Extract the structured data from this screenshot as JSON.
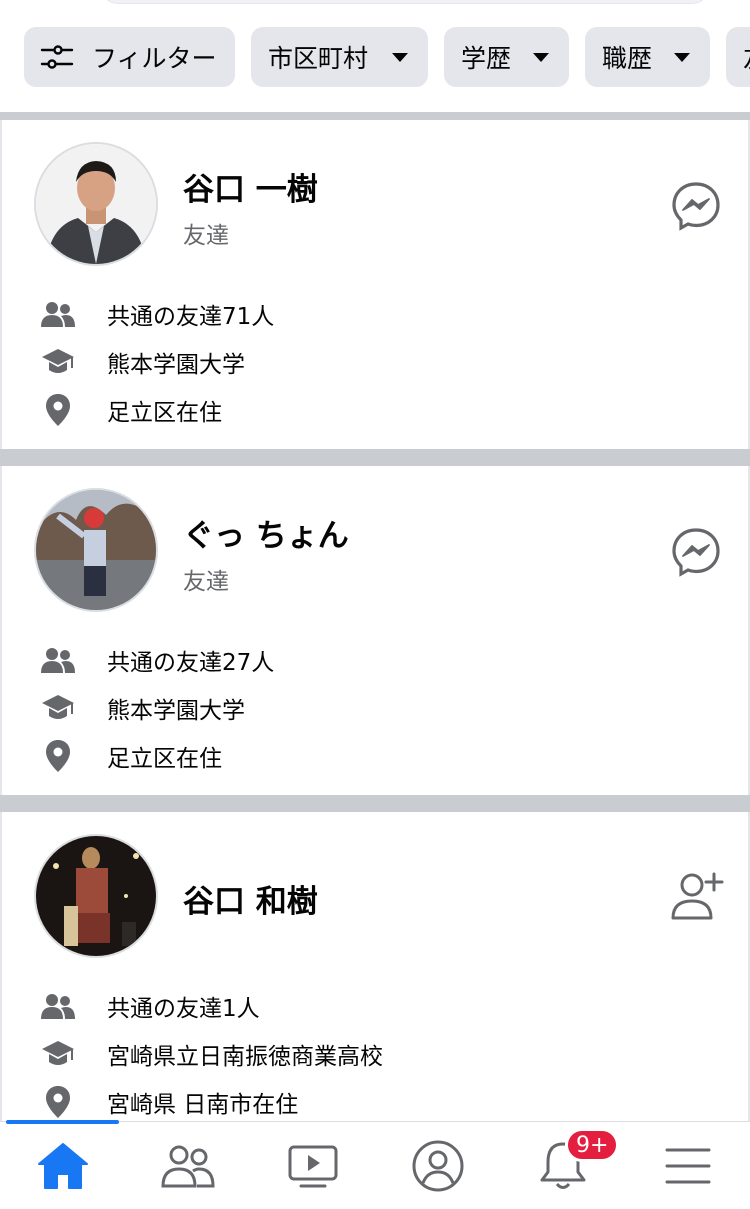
{
  "filters": [
    {
      "label": "フィルター",
      "icon": "sliders-icon"
    },
    {
      "label": "市区町村",
      "icon": "caret-down-icon"
    },
    {
      "label": "学歴",
      "icon": "caret-down-icon"
    },
    {
      "label": "職歴",
      "icon": "caret-down-icon"
    },
    {
      "label": "友",
      "icon": "caret-down-icon"
    }
  ],
  "results": [
    {
      "name": "谷口 一樹",
      "relation": "友達",
      "action_icon": "messenger-icon",
      "mutual_friends": "共通の友達71人",
      "education": "熊本学園大学",
      "location": "足立区在住"
    },
    {
      "name": "ぐっ ちょん",
      "relation": "友達",
      "action_icon": "messenger-icon",
      "mutual_friends": "共通の友達27人",
      "education": "熊本学園大学",
      "location": "足立区在住"
    },
    {
      "name": "谷口 和樹",
      "relation": "",
      "action_icon": "add-friend-icon",
      "mutual_friends": "共通の友達1人",
      "education": "宮崎県立日南振徳商業高校",
      "location": "宮崎県 日南市在住"
    }
  ],
  "tabbar": {
    "tabs": [
      "home-icon",
      "friends-icon",
      "watch-icon",
      "profile-icon",
      "notifications-icon",
      "menu-icon"
    ],
    "active_index": 0,
    "notification_badge": "9+"
  },
  "colors": {
    "accent": "#1877f2",
    "chip_bg": "#e4e6eb",
    "icon_gray": "#65676b",
    "badge_red": "#e41e3f",
    "separator": "#c9ccd1"
  }
}
